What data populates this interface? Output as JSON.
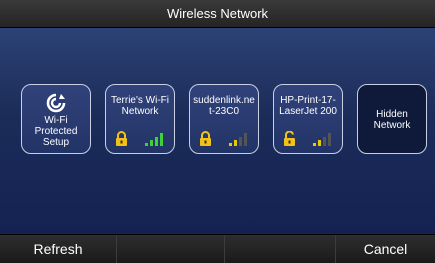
{
  "title": "Wireless Network",
  "tiles": [
    {
      "label": "Wi-Fi Protected Setup",
      "icon": "wps-icon"
    },
    {
      "label": "Terrie's Wi-Fi Network",
      "lock": "locked",
      "signal_bars": 4,
      "signal_color": "#3fd13a"
    },
    {
      "label": "suddenlink.net-23C0",
      "lock": "locked",
      "signal_bars": 2,
      "signal_color": "#e8c800"
    },
    {
      "label": "HP-Print-17-LaserJet 200",
      "lock": "unlocked",
      "signal_bars": 2,
      "signal_color": "#e8c800"
    },
    {
      "label": "Hidden Network"
    }
  ],
  "bottom": {
    "refresh_label": "Refresh",
    "cancel_label": "Cancel"
  },
  "colors": {
    "lock": "#f3c21a",
    "signal_off": "#555555"
  }
}
